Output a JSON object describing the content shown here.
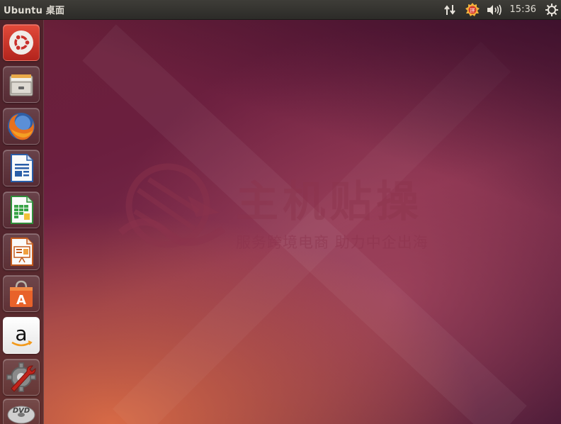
{
  "panel": {
    "title": "Ubuntu 桌面",
    "clock": "15:36",
    "indicators": [
      "network-icon",
      "input-method-icon",
      "volume-icon",
      "system-gear-icon"
    ]
  },
  "launcher": {
    "items": [
      {
        "name": "dash-home",
        "icon": "ubuntu-logo-icon"
      },
      {
        "name": "files",
        "icon": "file-cabinet-icon"
      },
      {
        "name": "firefox",
        "icon": "firefox-icon"
      },
      {
        "name": "libreoffice-writer",
        "icon": "writer-icon"
      },
      {
        "name": "libreoffice-calc",
        "icon": "calc-icon"
      },
      {
        "name": "libreoffice-impress",
        "icon": "impress-icon"
      },
      {
        "name": "ubuntu-software-center",
        "icon": "shopping-bag-icon"
      },
      {
        "name": "amazon",
        "icon": "amazon-icon"
      },
      {
        "name": "system-settings",
        "icon": "settings-wrench-icon"
      },
      {
        "name": "dvd",
        "icon": "dvd-icon"
      }
    ],
    "amazon_letter": "a",
    "software_letter": "A",
    "dvd_label": "DVD"
  },
  "watermark": {
    "title": "主机贴操",
    "subtitle": "服务跨境电商 助力中企出海"
  },
  "colors": {
    "panel": "#2c2b28",
    "launcher": "#4a2428",
    "accent": "#dd4814"
  }
}
